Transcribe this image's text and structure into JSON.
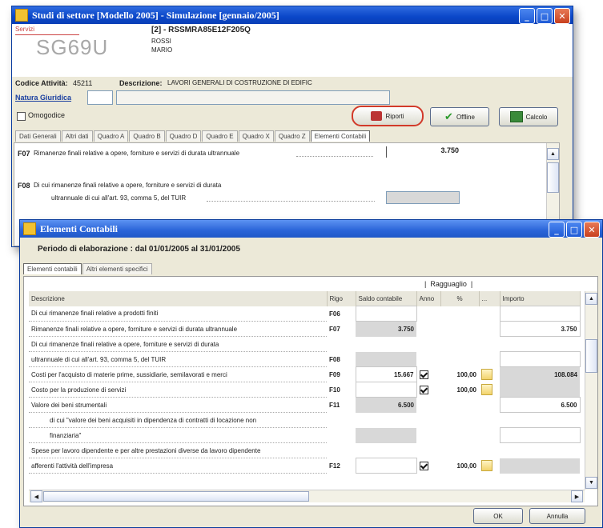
{
  "back_window": {
    "title": "Studi di settore  [Modello 2005] - Simulazione [gennaio/2005]",
    "logo_text": "SG69U",
    "logo_small": "Servizi",
    "taxpayer_code": "[2] - RSSMRA85E12F205Q",
    "surname": "ROSSI",
    "name": "MARIO",
    "activity_code_label": "Codice Attività:",
    "activity_code": "45211",
    "description_label": "Descrizione:",
    "description": "LAVORI GENERALI DI COSTRUZIONE DI EDIFIC",
    "legal_nature_label": "Natura Giuridica",
    "checkbox_label": "Omogodice",
    "buttons": {
      "reports": "Riporti",
      "offline": "Offline",
      "calc": "Calcolo"
    },
    "tabs": [
      "Dati Generali",
      "Altri dati",
      "Quadro A",
      "Quadro B",
      "Quadro D",
      "Quadro E",
      "Quadro X",
      "Quadro Z",
      "Elementi Contabili"
    ],
    "rows": [
      {
        "code": "F07",
        "text": "Rimanenze finali relative a opere, forniture e servizi di durata ultrannuale",
        "value": "3.750"
      },
      {
        "code": "F08",
        "text": "Di cui rimanenze finali relative a opere, forniture e servizi di durata",
        "text2": "ultrannuale di cui all'art. 93, comma 5, del TUIR",
        "value": ""
      }
    ]
  },
  "front_window": {
    "title": "Elementi Contabili",
    "period": "Periodo di elaborazione : dal 01/01/2005  al 31/01/2005",
    "tabs": [
      "Elementi contabili",
      "Altri elementi specifici"
    ],
    "group_header": "Ragguaglio",
    "columns": {
      "desc": "Descrizione",
      "rigo": "Rigo",
      "saldo": "Saldo contabile",
      "anno": "Anno",
      "perc": "%",
      "dots": "...",
      "importo": "Importo"
    },
    "rows": [
      {
        "desc": "Di cui rimanenze finali relative a prodotti finiti",
        "rigo": "F06",
        "saldo": "",
        "anno": false,
        "perc": "",
        "importo": "",
        "saldo_style": "white",
        "imp_style": "white"
      },
      {
        "desc": "Rimanenze finali relative a opere, forniture e servizi di durata ultrannuale",
        "rigo": "F07",
        "saldo": "3.750",
        "anno": false,
        "perc": "",
        "importo": "3.750",
        "saldo_style": "gray",
        "imp_style": "white"
      },
      {
        "desc": "Di cui rimanenze finali relative a opere, forniture e servizi di durata",
        "rigo": "",
        "saldo": "",
        "anno": false,
        "perc": "",
        "importo": "",
        "saldo_style": "none",
        "imp_style": "none"
      },
      {
        "desc": "ultrannuale di cui all'art. 93, comma 5, del TUIR",
        "rigo": "F08",
        "saldo": "",
        "anno": false,
        "perc": "",
        "importo": "",
        "saldo_style": "gray",
        "imp_style": "white"
      },
      {
        "desc": "Costi per l'acquisto di materie prime, sussidiarie, semilavorati e merci",
        "rigo": "F09",
        "saldo": "15.667",
        "anno": true,
        "perc": "100,00",
        "importo": "108.084",
        "saldo_style": "white",
        "imp_style": "gray"
      },
      {
        "desc": "Costo per la produzione di servizi",
        "rigo": "F10",
        "saldo": "",
        "anno": true,
        "perc": "100,00",
        "importo": "",
        "saldo_style": "white",
        "imp_style": "gray"
      },
      {
        "desc": "Valore dei beni strumentali",
        "rigo": "F11",
        "saldo": "6.500",
        "anno": false,
        "perc": "",
        "importo": "6.500",
        "saldo_style": "gray",
        "imp_style": "white"
      },
      {
        "desc": "di cui \"valore dei beni acquisiti in dipendenza di contratti di locazione non",
        "rigo": "",
        "saldo": "",
        "anno": false,
        "perc": "",
        "importo": "",
        "saldo_style": "none",
        "imp_style": "none",
        "indent": true
      },
      {
        "desc": "finanziaria\"",
        "rigo": "",
        "saldo": "",
        "anno": false,
        "perc": "",
        "importo": "",
        "saldo_style": "gray",
        "imp_style": "white",
        "indent": true
      },
      {
        "desc": "Spese per lavoro dipendente e per altre prestazioni diverse da lavoro dipendente",
        "rigo": "",
        "saldo": "",
        "anno": false,
        "perc": "",
        "importo": "",
        "saldo_style": "none",
        "imp_style": "none"
      },
      {
        "desc": "afferenti l'attività dell'impresa",
        "rigo": "F12",
        "saldo": "",
        "anno": true,
        "perc": "100,00",
        "importo": "",
        "saldo_style": "white",
        "imp_style": "gray"
      }
    ],
    "footer": {
      "ok": "OK",
      "cancel": "Annulla"
    }
  }
}
